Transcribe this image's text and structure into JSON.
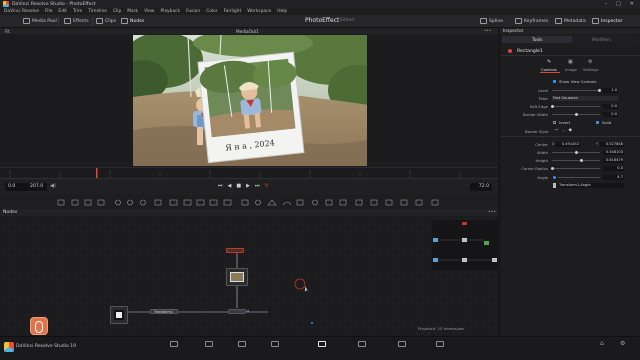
{
  "window": {
    "title": "DaVinci Resolve Studio - PhotoEffect",
    "min": "–",
    "max": "□",
    "close": "✕"
  },
  "menu": [
    "DaVinci Resolve",
    "File",
    "Edit",
    "Trim",
    "Timeline",
    "Clip",
    "Mark",
    "View",
    "Playback",
    "Fusion",
    "Color",
    "Fairlight",
    "Workspace",
    "Help"
  ],
  "toolbar": {
    "media_pool": "Media Pool",
    "effects": "Effects",
    "clips": "Clips",
    "nodes": "Nodes",
    "project_title": "PhotoEffect",
    "edited": "Edited",
    "spline": "Spline",
    "keyframes": "Keyframes",
    "metadata": "Metadata",
    "inspector": "Inspector"
  },
  "viewer": {
    "label": "MediaOut1",
    "zoom": "Fit",
    "photo_caption": "Я н а ,  2024"
  },
  "transport": {
    "timecode_start": "0.0",
    "timecode_end": "207.0",
    "current_frame": "72.0"
  },
  "nodes_panel": {
    "header": "Nodes",
    "transform_node": "Transform1",
    "status": "Playback: 25 frames/sec",
    "memory": "17% - 8128 MB"
  },
  "inspector": {
    "title": "Inspector",
    "tab_tools": "Tools",
    "tab_modifiers": "Modifiers",
    "node_name": "Rectangle1",
    "subtabs": [
      "Controls",
      "Image",
      "Settings"
    ],
    "show_view_controls": "Show View Controls",
    "fields": [
      {
        "label": "Level",
        "value": "1.0"
      },
      {
        "label": "Filter",
        "value": "Fast Gaussian"
      },
      {
        "label": "Soft Edge",
        "value": "0.0"
      },
      {
        "label": "Border Width",
        "value": "0.0"
      }
    ],
    "invert": "Invert",
    "solid": "Solid",
    "border_style": "Border Style",
    "center_label": "Center",
    "center_x": "0.491452",
    "center_y": "0.527848",
    "width_label": "Width",
    "width_value": "0.548103",
    "height_label": "Height",
    "height_value": "0.616479",
    "corner_radius_label": "Corner Radius",
    "corner_radius_value": "0.0",
    "angle_label": "Angle",
    "angle_value": "4.7",
    "angle_expression": "Transform1.Angle"
  },
  "bottom_bar": {
    "app_name": "DaVinci Resolve Studio 19"
  },
  "colors": {
    "accent": "#e2453c",
    "selection": "#3b8ede"
  }
}
